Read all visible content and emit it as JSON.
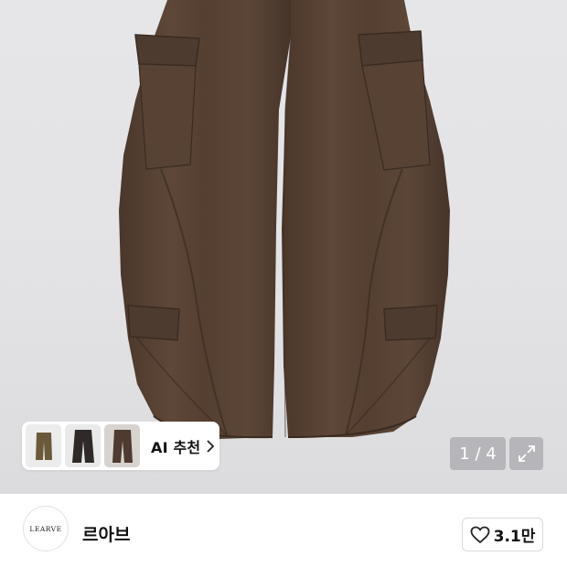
{
  "product_image": {
    "alt": "brown cargo pants",
    "pager": {
      "current": "1",
      "separator": " / ",
      "total": "4"
    }
  },
  "recommendation": {
    "label": "AI 추천",
    "thumbnails": [
      "olive-cargo-pants",
      "dark-cargo-pants",
      "brown-cargo-pants"
    ]
  },
  "seller": {
    "logo_text": "LEARVE",
    "name": "르아브"
  },
  "like": {
    "count": "3.1만"
  },
  "colors": {
    "pants": "#5a4436",
    "background": "#e4e4e6"
  }
}
